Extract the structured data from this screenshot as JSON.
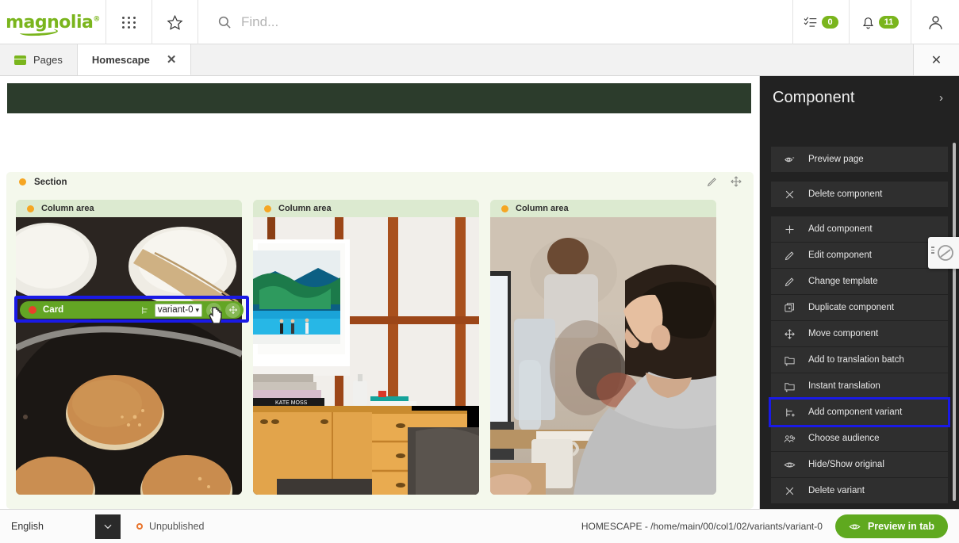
{
  "topbar": {
    "logo": "magnolia",
    "logo_reg": "®",
    "apps_icon": "grid-apps-icon",
    "star_icon": "star-icon",
    "search_icon": "search-icon",
    "search_placeholder": "Find...",
    "tasks_icon": "tasks-checklist-icon",
    "tasks_count": "0",
    "notifications_icon": "bell-icon",
    "notifications_count": "11",
    "user_icon": "user-avatar-icon",
    "accent_green": "#7ab51d"
  },
  "tabs": {
    "items": [
      {
        "label": "Pages",
        "icon": "pages-icon",
        "active": false,
        "closable": false
      },
      {
        "label": "Homescape",
        "icon": "",
        "active": true,
        "closable": true
      }
    ],
    "close_tab_label": "✕",
    "close_all_label": "✕"
  },
  "canvas": {
    "section": {
      "label": "Section",
      "edit_icon": "pencil-icon",
      "move_icon": "move-arrows-icon"
    },
    "columns": [
      {
        "label": "Column area",
        "image_alt": "pancakes-in-cast-iron-pan"
      },
      {
        "label": "Column area",
        "image_alt": "living-room-artwork-credenza"
      },
      {
        "label": "Column area",
        "image_alt": "man-working-at-desk-office"
      }
    ],
    "card": {
      "label": "Card",
      "status_dot": "red",
      "variant_icon": "variant-icon",
      "variant_value": "variant-0",
      "variant_options": [
        "variant-0"
      ],
      "personalization_icon": "personalization-icon",
      "move_icon": "move-arrows-icon",
      "highlight_color": "#1a1ae6"
    },
    "banner_color": "#2c3c2c"
  },
  "panel": {
    "title": "Component",
    "expand_icon": "chevron-right-icon",
    "groups": [
      {
        "items": [
          {
            "label": "Preview page",
            "icon": "preview-page-icon",
            "highlighted": false
          },
          {
            "label": "Delete component",
            "icon": "close-x-icon",
            "highlighted": false
          }
        ]
      },
      {
        "items": [
          {
            "label": "Add component",
            "icon": "plus-icon",
            "highlighted": false
          },
          {
            "label": "Edit component",
            "icon": "pencil-icon",
            "highlighted": false
          },
          {
            "label": "Change template",
            "icon": "pencil-icon",
            "highlighted": false
          },
          {
            "label": "Duplicate component",
            "icon": "duplicate-icon",
            "highlighted": false
          },
          {
            "label": "Move component",
            "icon": "move-arrows-icon",
            "highlighted": false
          },
          {
            "label": "Add to translation batch",
            "icon": "folder-plus-icon",
            "highlighted": false
          },
          {
            "label": "Instant translation",
            "icon": "folder-plus-icon",
            "highlighted": false
          },
          {
            "label": "Add component variant",
            "icon": "variant-plus-icon",
            "highlighted": true
          },
          {
            "label": "Choose audience",
            "icon": "audience-group-icon",
            "highlighted": false
          },
          {
            "label": "Hide/Show original",
            "icon": "eye-icon",
            "highlighted": false
          },
          {
            "label": "Delete variant",
            "icon": "close-x-icon",
            "highlighted": false
          }
        ]
      }
    ],
    "floating_popup_icon": "blocked-circle-icon"
  },
  "bottombar": {
    "language": "English",
    "language_chevron": "chevron-down-icon",
    "status_icon": "unpublished-ring-icon",
    "status": "Unpublished",
    "path": "HOMESCAPE - /home/main/00/col1/02/variants/variant-0",
    "preview_icon": "eye-icon",
    "preview_label": "Preview in tab",
    "preview_color": "#5fa91f"
  }
}
